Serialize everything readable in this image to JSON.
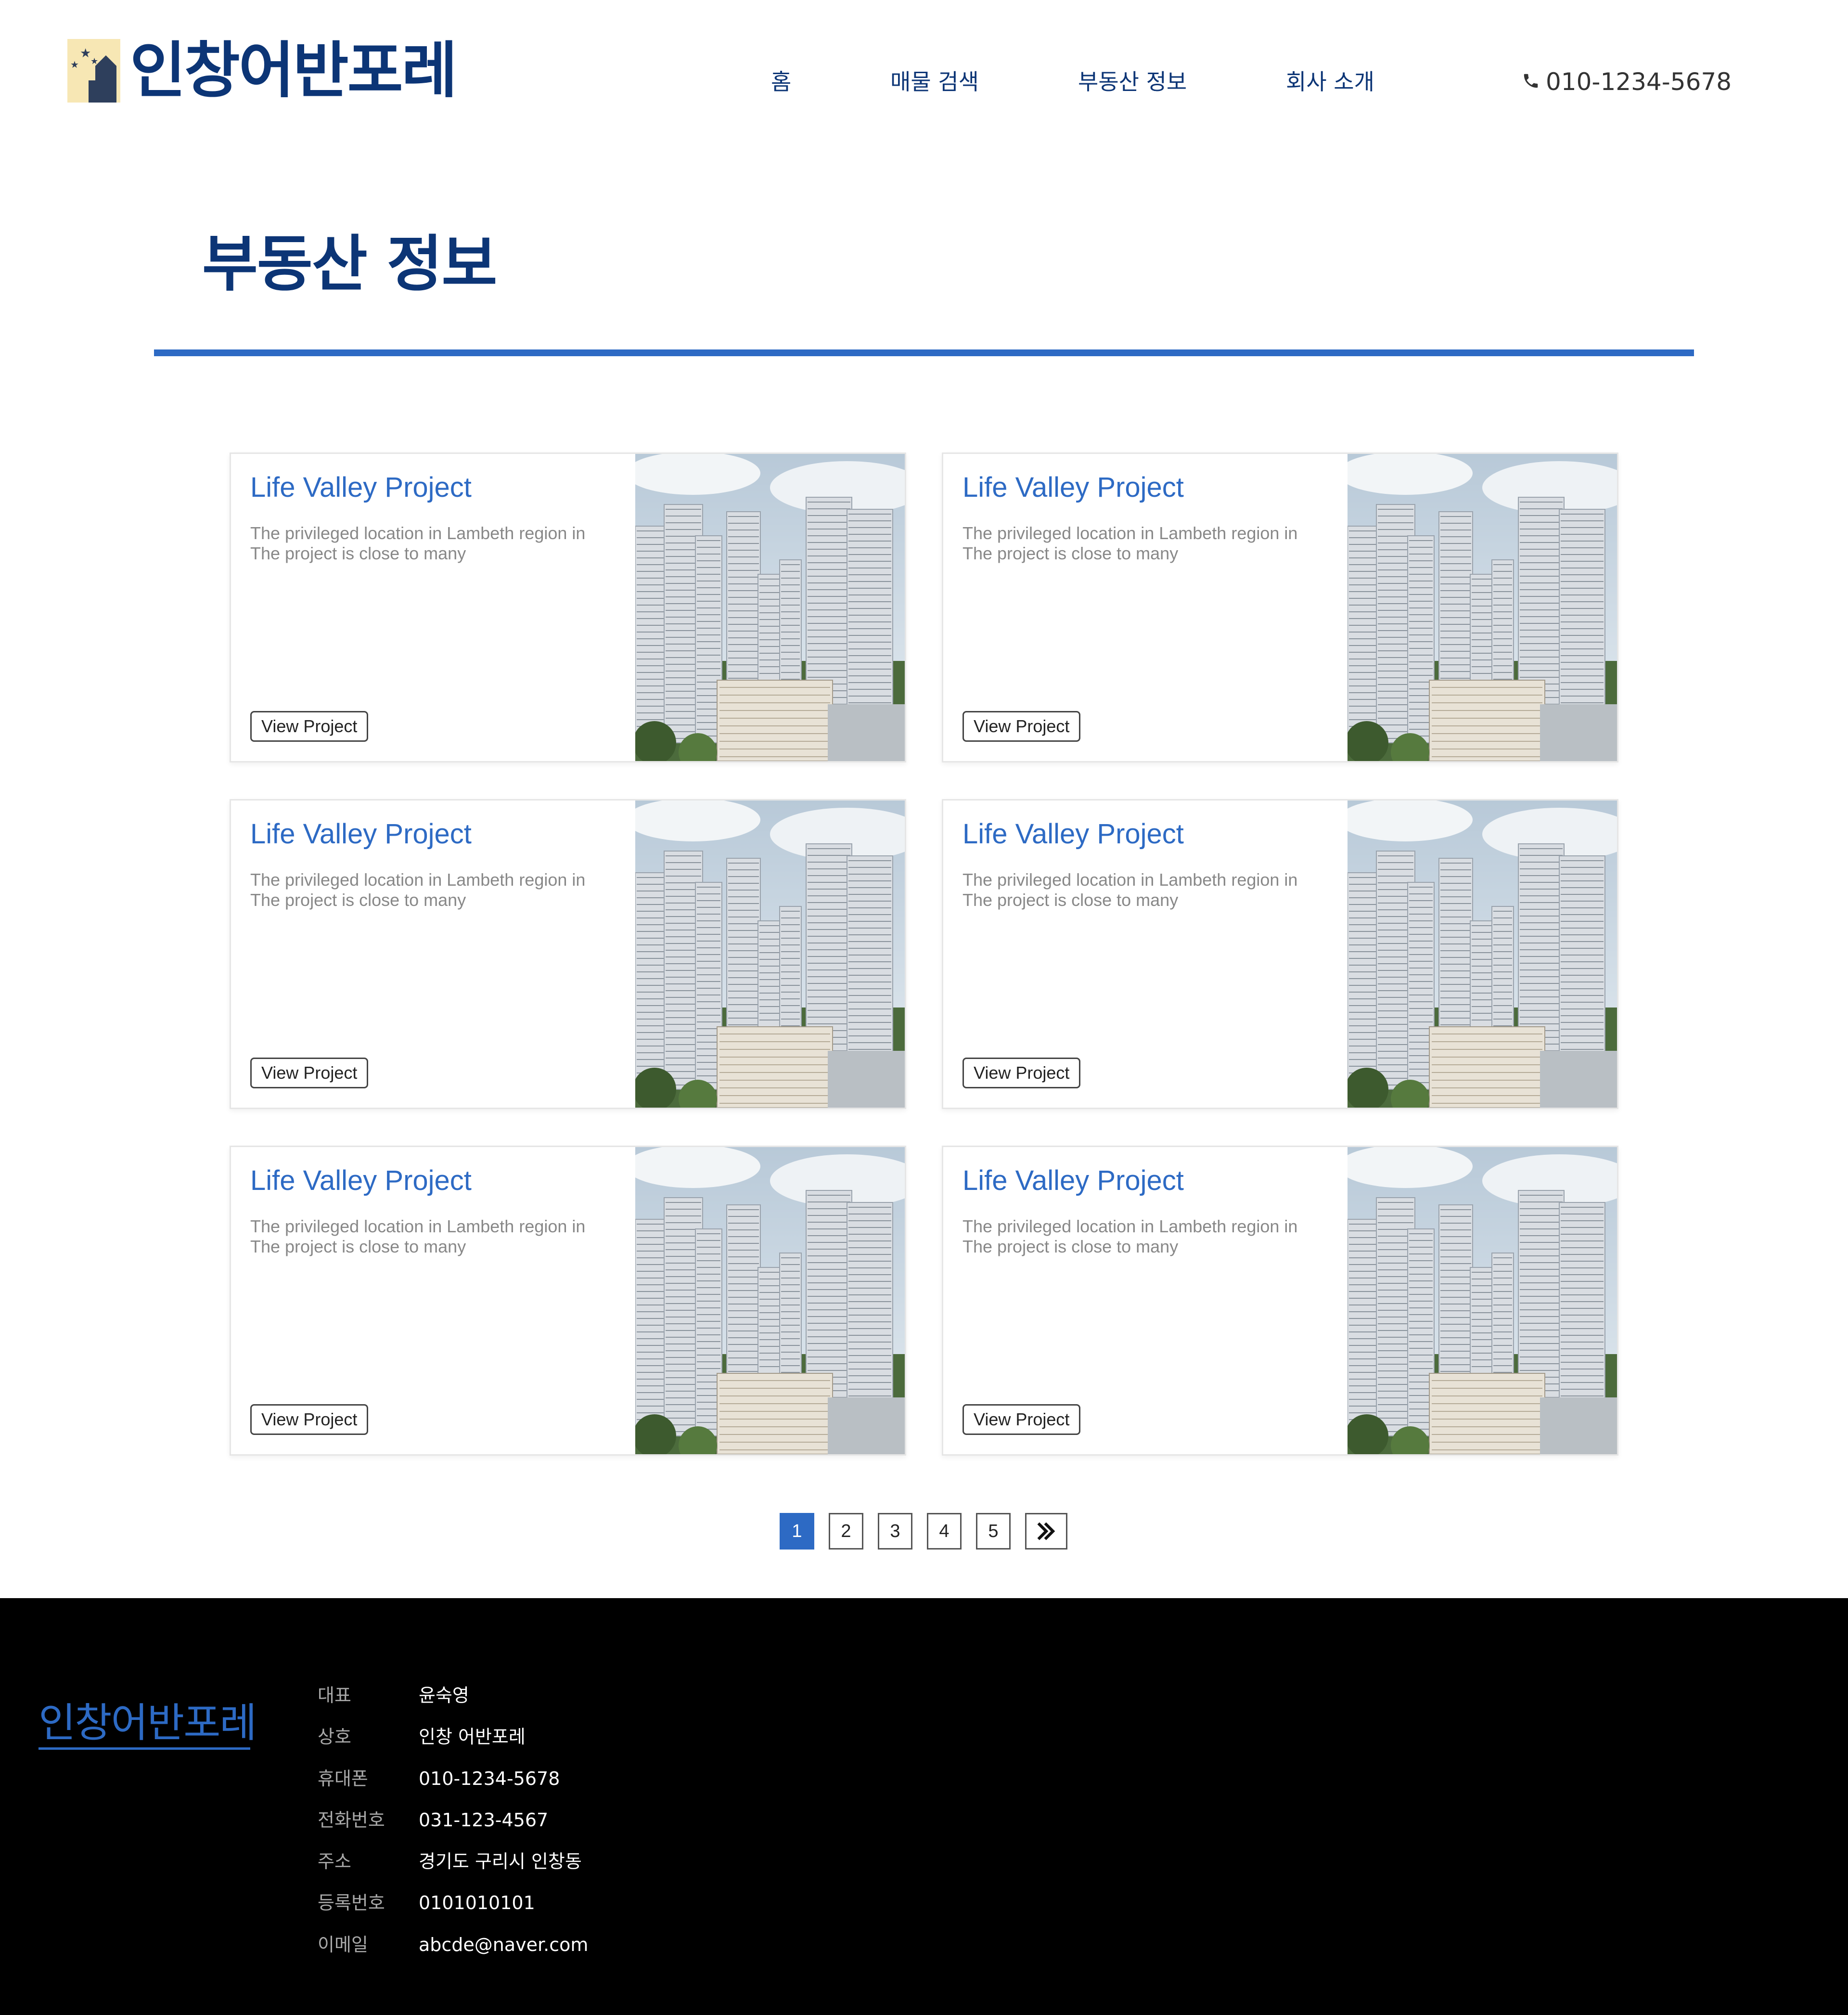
{
  "header": {
    "logo_text": "인창어반포레",
    "nav": [
      {
        "label": "홈"
      },
      {
        "label": "매물 검색"
      },
      {
        "label": "부동산 정보"
      },
      {
        "label": "회사 소개"
      }
    ],
    "phone": "010-1234-5678"
  },
  "page": {
    "title": "부동산 정보"
  },
  "cards": [
    {
      "title": "Life Valley Project",
      "desc_line1": "The privileged location in Lambeth region in",
      "desc_line2": "The project is close to many",
      "button": "View Project"
    },
    {
      "title": "Life Valley Project",
      "desc_line1": "The privileged location in Lambeth region in",
      "desc_line2": "The project is close to many",
      "button": "View Project"
    },
    {
      "title": "Life Valley Project",
      "desc_line1": "The privileged location in Lambeth region in",
      "desc_line2": "The project is close to many",
      "button": "View Project"
    },
    {
      "title": "Life Valley Project",
      "desc_line1": "The privileged location in Lambeth region in",
      "desc_line2": "The project is close to many",
      "button": "View Project"
    },
    {
      "title": "Life Valley Project",
      "desc_line1": "The privileged location in Lambeth region in",
      "desc_line2": "The project is close to many",
      "button": "View Project"
    },
    {
      "title": "Life Valley Project",
      "desc_line1": "The privileged location in Lambeth region in",
      "desc_line2": "The project is close to many",
      "button": "View Project"
    }
  ],
  "pagination": {
    "pages": [
      "1",
      "2",
      "3",
      "4",
      "5"
    ],
    "active": "1",
    "next_icon": "double-chevron-right-icon"
  },
  "footer": {
    "logo_text": "인창어반포레",
    "info": [
      {
        "label": "대표",
        "value": "윤숙영"
      },
      {
        "label": "상호",
        "value": "인창 어반포레"
      },
      {
        "label": "휴대폰",
        "value": "010-1234-5678"
      },
      {
        "label": "전화번호",
        "value": "031-123-4567"
      },
      {
        "label": "주소",
        "value": "경기도 구리시 인창동"
      },
      {
        "label": "등록번호",
        "value": "0101010101"
      },
      {
        "label": "이메일",
        "value": "abcde@naver.com"
      }
    ]
  },
  "colors": {
    "brand_navy": "#0c3576",
    "accent_blue": "#2d6ac4",
    "footer_bg": "#000000",
    "logo_bg": "#f7e7b4"
  }
}
